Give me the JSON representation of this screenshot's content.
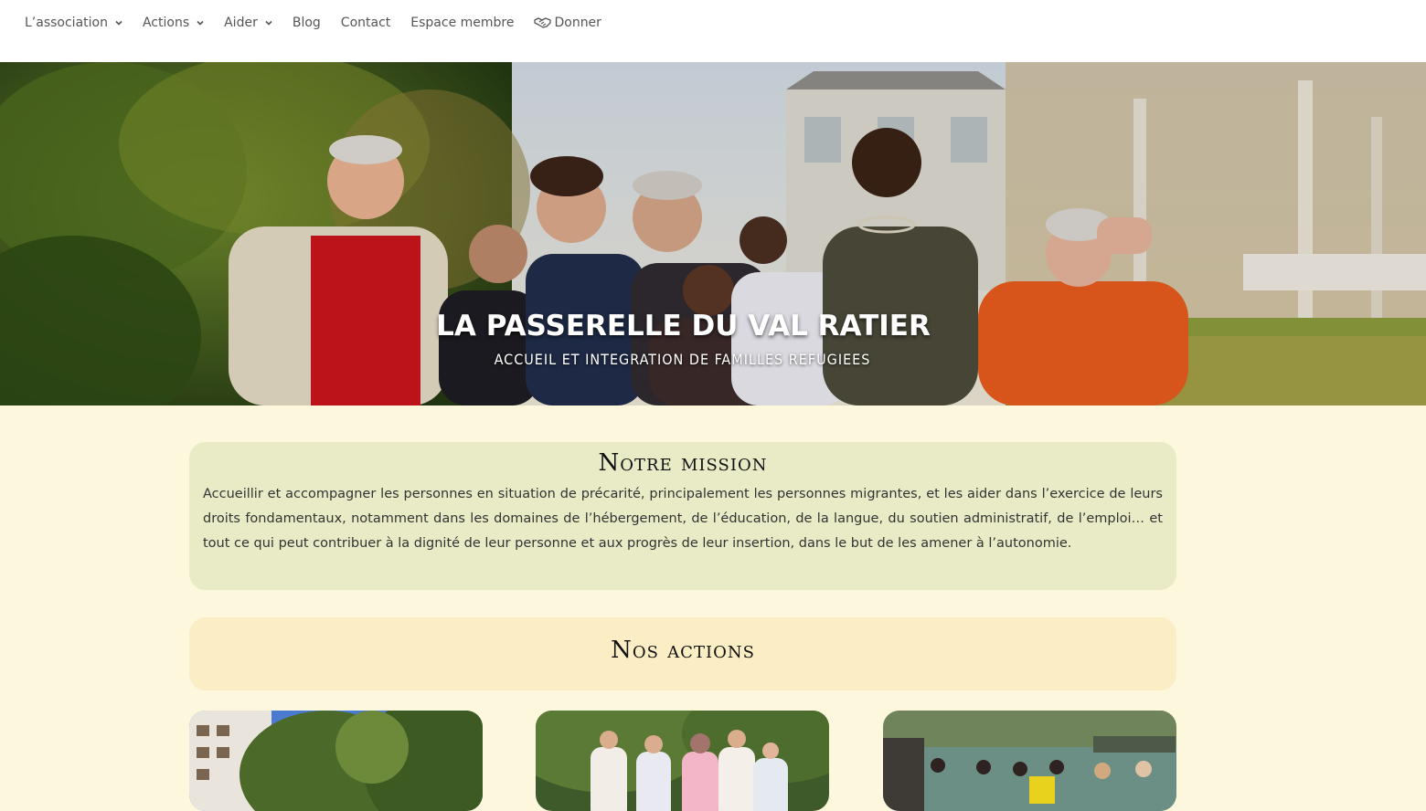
{
  "nav": {
    "items": [
      {
        "label": "L’association",
        "has_dropdown": true
      },
      {
        "label": "Actions",
        "has_dropdown": true
      },
      {
        "label": "Aider",
        "has_dropdown": true
      },
      {
        "label": "Blog",
        "has_dropdown": false
      },
      {
        "label": "Contact",
        "has_dropdown": false
      },
      {
        "label": "Espace membre",
        "has_dropdown": false
      },
      {
        "label": "Donner",
        "has_dropdown": false,
        "icon": "handshake-icon"
      }
    ]
  },
  "hero": {
    "title": "LA PASSERELLE DU VAL RATIER",
    "subtitle": "ACCUEIL ET INTEGRATION DE FAMILLES REFUGIEES"
  },
  "mission": {
    "title": "Notre mission",
    "text": "Accueillir et accompagner les personnes en situation de précarité, principalement les personnes migrantes, et les aider dans l’exercice de leurs droits fondamentaux, notamment dans les domaines de l’hébergement, de l’éducation, de la langue, du soutien administratif, de l’emploi… et tout ce qui peut contribuer à la dignité de leur personne et aux progrès de leur insertion, dans le but de les amener à l’autonomie."
  },
  "actions": {
    "title": "Nos actions"
  },
  "colors": {
    "page_background": "#fdf7dd",
    "mission_background": "#e8ebc6",
    "actions_background": "#fbedc4",
    "nav_text": "#555555"
  }
}
